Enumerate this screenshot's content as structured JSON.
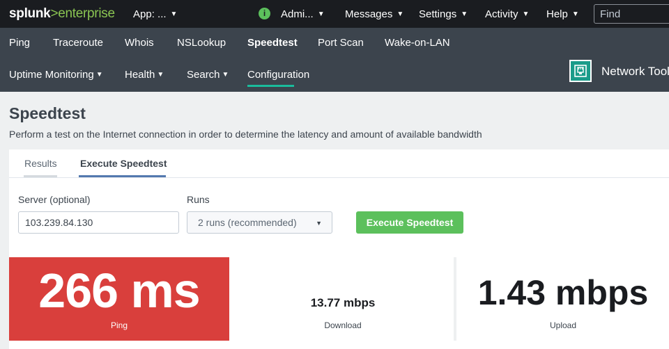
{
  "topbar": {
    "logo_main": "splunk",
    "logo_sep": ">",
    "logo_product": "enterprise",
    "app_label": "App: ...",
    "admin_label": "Admi...",
    "messages_label": "Messages",
    "settings_label": "Settings",
    "activity_label": "Activity",
    "help_label": "Help",
    "find_placeholder": "Find"
  },
  "appnav": {
    "row1": [
      "Ping",
      "Traceroute",
      "Whois",
      "NSLookup",
      "Speedtest",
      "Port Scan",
      "Wake-on-LAN"
    ],
    "row2": [
      "Uptime Monitoring",
      "Health",
      "Search",
      "Configuration"
    ],
    "active": "Speedtest",
    "app_title": "Network Toolkit",
    "accent": "#1abc9c"
  },
  "page": {
    "title": "Speedtest",
    "description": "Perform a test on the Internet connection in order to determine the latency and amount of available bandwidth"
  },
  "tabs": {
    "results": "Results",
    "execute": "Execute Speedtest"
  },
  "form": {
    "server_label": "Server (optional)",
    "server_value": "103.239.84.130",
    "runs_label": "Runs",
    "runs_selected": "2 runs (recommended)",
    "execute_button": "Execute Speedtest",
    "button_color": "#5cc05c"
  },
  "results": {
    "ping_value": "266 ms",
    "ping_label": "Ping",
    "ping_color": "#d93f3c",
    "download_value": "13.77 mbps",
    "download_label": "Download",
    "upload_value": "1.43 mbps",
    "upload_label": "Upload"
  },
  "icons": {
    "info": "info-icon",
    "app": "network-port-icon",
    "caret": "caret-down-icon"
  }
}
